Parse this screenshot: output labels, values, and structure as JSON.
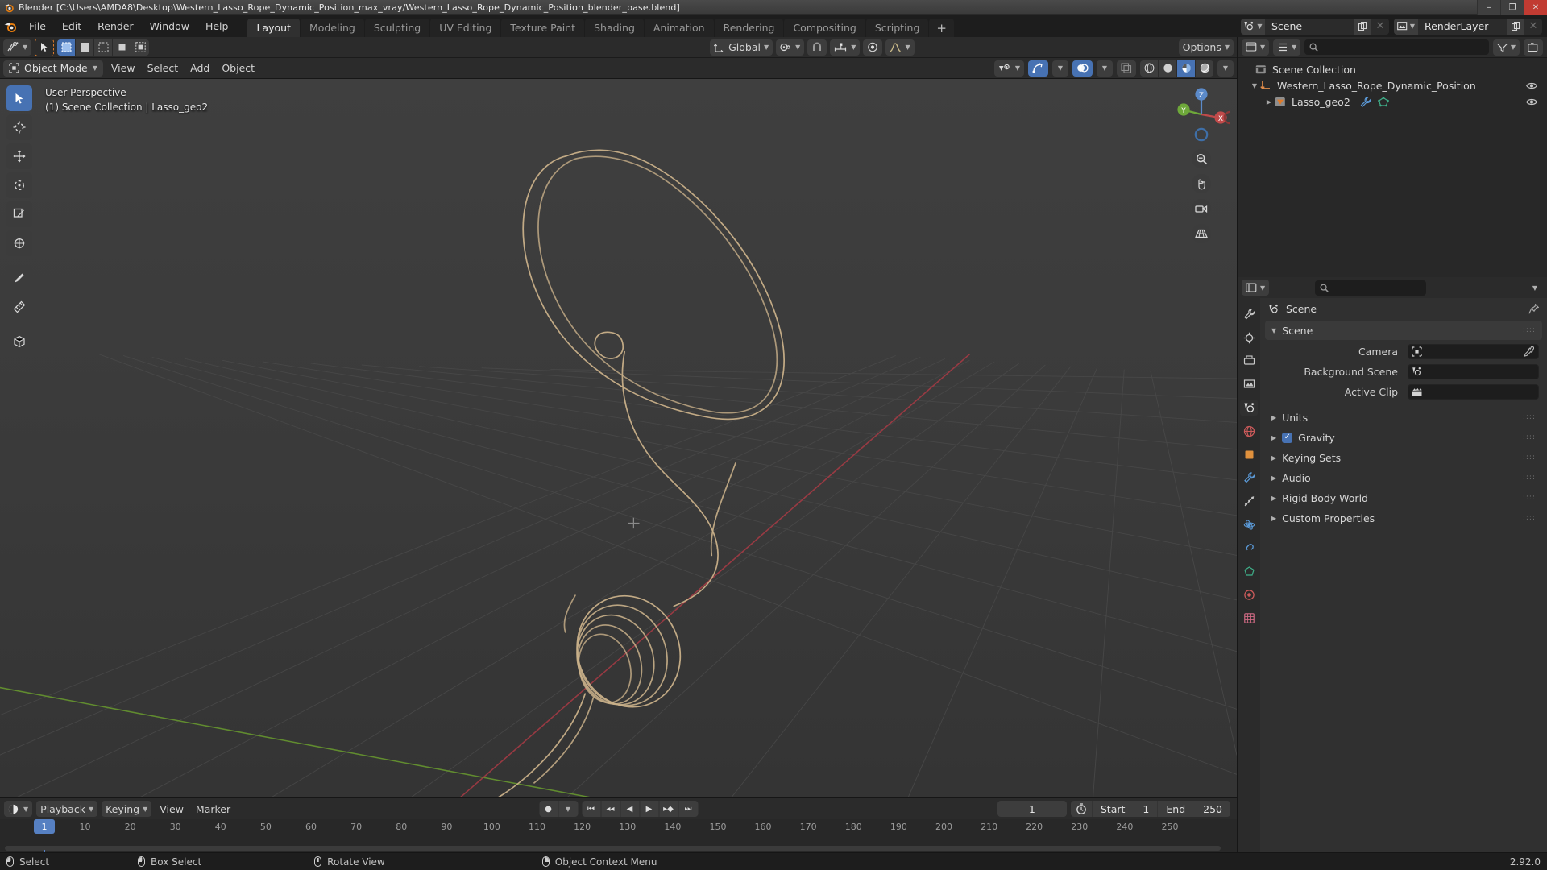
{
  "window": {
    "title": "Blender [C:\\Users\\AMDA8\\Desktop\\Western_Lasso_Rope_Dynamic_Position_max_vray/Western_Lasso_Rope_Dynamic_Position_blender_base.blend]",
    "minimize": "–",
    "maximize": "❐",
    "close": "✕"
  },
  "topbar": {
    "menus": [
      "File",
      "Edit",
      "Render",
      "Window",
      "Help"
    ],
    "workspaces": [
      {
        "label": "Layout",
        "active": true
      },
      {
        "label": "Modeling",
        "active": false
      },
      {
        "label": "Sculpting",
        "active": false
      },
      {
        "label": "UV Editing",
        "active": false
      },
      {
        "label": "Texture Paint",
        "active": false
      },
      {
        "label": "Shading",
        "active": false
      },
      {
        "label": "Animation",
        "active": false
      },
      {
        "label": "Rendering",
        "active": false
      },
      {
        "label": "Compositing",
        "active": false
      },
      {
        "label": "Scripting",
        "active": false
      }
    ],
    "add_workspace": "+",
    "scene_name": "Scene",
    "viewlayer_name": "RenderLayer"
  },
  "viewport": {
    "mode": "Object Mode",
    "menus": [
      "View",
      "Select",
      "Add",
      "Object"
    ],
    "transform_orientation": "Global",
    "options_label": "Options",
    "overlay_line1": "User Perspective",
    "overlay_line2": "(1) Scene Collection | Lasso_geo2",
    "gizmo_axes": {
      "x": "X",
      "y": "Y",
      "z": "Z"
    }
  },
  "outliner": {
    "search_placeholder": "",
    "rows": [
      {
        "label": "Scene Collection",
        "indent": 0,
        "disclosure": "",
        "icon": "collection-icon",
        "eye": false
      },
      {
        "label": "Western_Lasso_Rope_Dynamic_Position",
        "indent": 1,
        "disclosure": "▼",
        "icon": "empty-axes-icon",
        "eye": true
      },
      {
        "label": "Lasso_geo2",
        "indent": 2,
        "disclosure": "▶",
        "icon": "mesh-data-icon",
        "eye": true
      }
    ]
  },
  "properties": {
    "breadcrumb": "Scene",
    "panels": [
      {
        "label": "Scene",
        "open": true,
        "checkbox": null
      },
      {
        "label": "Units",
        "open": false,
        "checkbox": null
      },
      {
        "label": "Gravity",
        "open": false,
        "checkbox": true
      },
      {
        "label": "Keying Sets",
        "open": false,
        "checkbox": null
      },
      {
        "label": "Audio",
        "open": false,
        "checkbox": null
      },
      {
        "label": "Rigid Body World",
        "open": false,
        "checkbox": null
      },
      {
        "label": "Custom Properties",
        "open": false,
        "checkbox": null
      }
    ],
    "fields": [
      {
        "label": "Camera",
        "value": "",
        "icon": "camera-icon",
        "right_icon": "eyedropper-icon"
      },
      {
        "label": "Background Scene",
        "value": "",
        "icon": "scene-icon",
        "right_icon": ""
      },
      {
        "label": "Active Clip",
        "value": "",
        "icon": "clip-icon",
        "right_icon": ""
      }
    ]
  },
  "timeline": {
    "editor_menu_icon": "timeline-editor-icon",
    "menus": [
      "Playback",
      "Keying",
      "View",
      "Marker"
    ],
    "transport": [
      "jump-start",
      "prev-keyframe",
      "play-reverse",
      "play",
      "next-keyframe",
      "jump-end"
    ],
    "current_frame": "1",
    "start_label": "Start",
    "start_value": "1",
    "end_label": "End",
    "end_value": "250",
    "ticks": [
      "10",
      "20",
      "30",
      "40",
      "50",
      "60",
      "70",
      "80",
      "90",
      "100",
      "110",
      "120",
      "130",
      "140",
      "150",
      "160",
      "170",
      "180",
      "190",
      "200",
      "210",
      "220",
      "230",
      "240",
      "250"
    ],
    "playhead_label": "1"
  },
  "statusbar": {
    "items": [
      {
        "icon": "mouse-left-icon",
        "label": "Select"
      },
      {
        "icon": "mouse-left-drag-icon",
        "label": "Box Select"
      },
      {
        "icon": "mouse-middle-icon",
        "label": "Rotate View"
      },
      {
        "icon": "mouse-right-icon",
        "label": "Object Context Menu"
      }
    ],
    "version": "2.92.0"
  },
  "colors": {
    "accent_blue": "#4772b3",
    "active_orange": "#e07b2a",
    "rope": "#c9b089",
    "grid_line": "#4b4b4b",
    "axis_x_red": "#c7484f",
    "axis_y_green": "#6fa53a",
    "panel_bg": "#303030",
    "header_bg": "#2b2b2b"
  }
}
